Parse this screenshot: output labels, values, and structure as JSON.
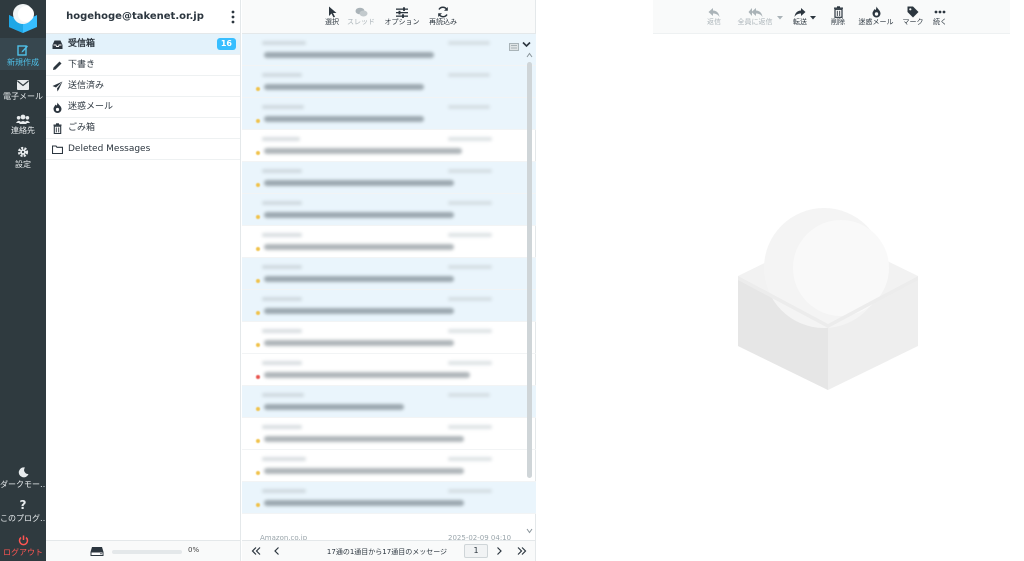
{
  "nav": {
    "compose": "新規作成",
    "mail": "電子メール",
    "contacts": "連絡先",
    "settings": "設定",
    "dark_mode": "ダークモー…",
    "about": "このプログ…",
    "logout": "ログアウト"
  },
  "account": {
    "email": "hogehoge@takenet.or.jp"
  },
  "folders": [
    {
      "name": "受信箱",
      "count": "16",
      "icon": "inbox-icon"
    },
    {
      "name": "下書き",
      "icon": "pencil-icon"
    },
    {
      "name": "送信済み",
      "icon": "paper-plane-icon"
    },
    {
      "name": "迷惑メール",
      "icon": "fire-icon"
    },
    {
      "name": "ごみ箱",
      "icon": "trash-icon"
    },
    {
      "name": "Deleted Messages",
      "icon": "folder-icon"
    }
  ],
  "quota": {
    "percent_label": "0%",
    "fraction": 0.0
  },
  "list_toolbar": {
    "select": "選択",
    "thread": "スレッド",
    "options": "オプション",
    "refresh": "再読込み"
  },
  "message_rows": [
    {
      "unread": true,
      "dot": "none"
    },
    {
      "unread": true,
      "dot": "yellow"
    },
    {
      "unread": true,
      "dot": "yellow"
    },
    {
      "unread": false,
      "dot": "yellow"
    },
    {
      "unread": true,
      "dot": "yellow"
    },
    {
      "unread": true,
      "dot": "yellow"
    },
    {
      "unread": false,
      "dot": "yellow"
    },
    {
      "unread": true,
      "dot": "yellow"
    },
    {
      "unread": true,
      "dot": "yellow"
    },
    {
      "unread": false,
      "dot": "yellow"
    },
    {
      "unread": false,
      "dot": "red"
    },
    {
      "unread": true,
      "dot": "yellow"
    },
    {
      "unread": false,
      "dot": "yellow"
    },
    {
      "unread": false,
      "dot": "yellow"
    },
    {
      "unread": true,
      "dot": "yellow"
    }
  ],
  "peek_sender": "Amazon.co.jp",
  "peek_date": "2025-02-09 04:10",
  "list_footer": {
    "info": "17通の1通目から17通目のメッセージ",
    "page": "1"
  },
  "reader_toolbar": {
    "reply": "返信",
    "reply_all": "全員に返信",
    "forward": "転送",
    "delete": "削除",
    "spam": "迷惑メール",
    "mark": "マーク",
    "more": "続く"
  },
  "colors": {
    "nav_bg": "#2f3a3f",
    "accent": "#37beff",
    "logout": "#ff5552",
    "selected_row": "#e3f2fb"
  }
}
